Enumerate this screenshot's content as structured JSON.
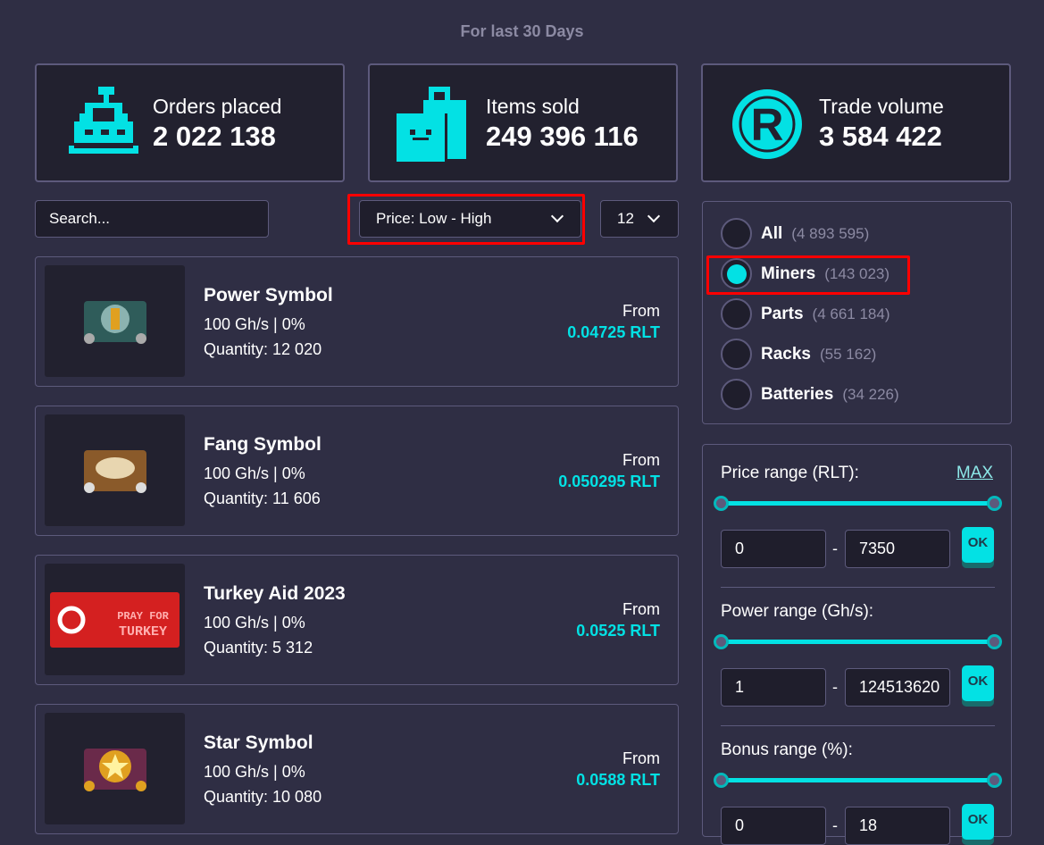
{
  "subtitle": "For last 30 Days",
  "stats": [
    {
      "label": "Orders placed",
      "value": "2 022 138",
      "icon": "cash-register-icon"
    },
    {
      "label": "Items sold",
      "value": "249 396 116",
      "icon": "shopping-bags-icon"
    },
    {
      "label": "Trade volume",
      "value": "3 584 422",
      "icon": "rlt-coin-icon"
    }
  ],
  "search": {
    "placeholder": "Search..."
  },
  "sort": {
    "selected": "Price: Low - High"
  },
  "per_page": {
    "selected": "12"
  },
  "products": [
    {
      "name": "Power Symbol",
      "power": "100 Gh/s | 0%",
      "quantity": "Quantity: 12 020",
      "from": "From",
      "price": "0.04725 RLT"
    },
    {
      "name": "Fang Symbol",
      "power": "100 Gh/s | 0%",
      "quantity": "Quantity: 11 606",
      "from": "From",
      "price": "0.050295 RLT"
    },
    {
      "name": "Turkey Aid 2023",
      "power": "100 Gh/s | 0%",
      "quantity": "Quantity: 5 312",
      "from": "From",
      "price": "0.0525 RLT",
      "image_text": "PRAY FOR TURKEY"
    },
    {
      "name": "Star Symbol",
      "power": "100 Gh/s | 0%",
      "quantity": "Quantity: 10 080",
      "from": "From",
      "price": "0.0588 RLT"
    }
  ],
  "categories": [
    {
      "label": "All",
      "count": "(4 893 595)",
      "selected": false
    },
    {
      "label": "Miners",
      "count": "(143 023)",
      "selected": true
    },
    {
      "label": "Parts",
      "count": "(4 661 184)",
      "selected": false
    },
    {
      "label": "Racks",
      "count": "(55 162)",
      "selected": false
    },
    {
      "label": "Batteries",
      "count": "(34 226)",
      "selected": false
    }
  ],
  "ranges": {
    "price": {
      "label": "Price range (RLT):",
      "max_link": "MAX",
      "min": "0",
      "max": "7350",
      "ok": "OK"
    },
    "power": {
      "label": "Power range (Gh/s):",
      "min": "1",
      "max": "124513620",
      "ok": "OK"
    },
    "bonus": {
      "label": "Bonus range (%):",
      "min": "0",
      "max": "18",
      "ok": "OK"
    }
  },
  "colors": {
    "accent": "#03e1e4",
    "background": "#2f2e44",
    "card": "#22212f",
    "highlight": "#ff0000"
  }
}
